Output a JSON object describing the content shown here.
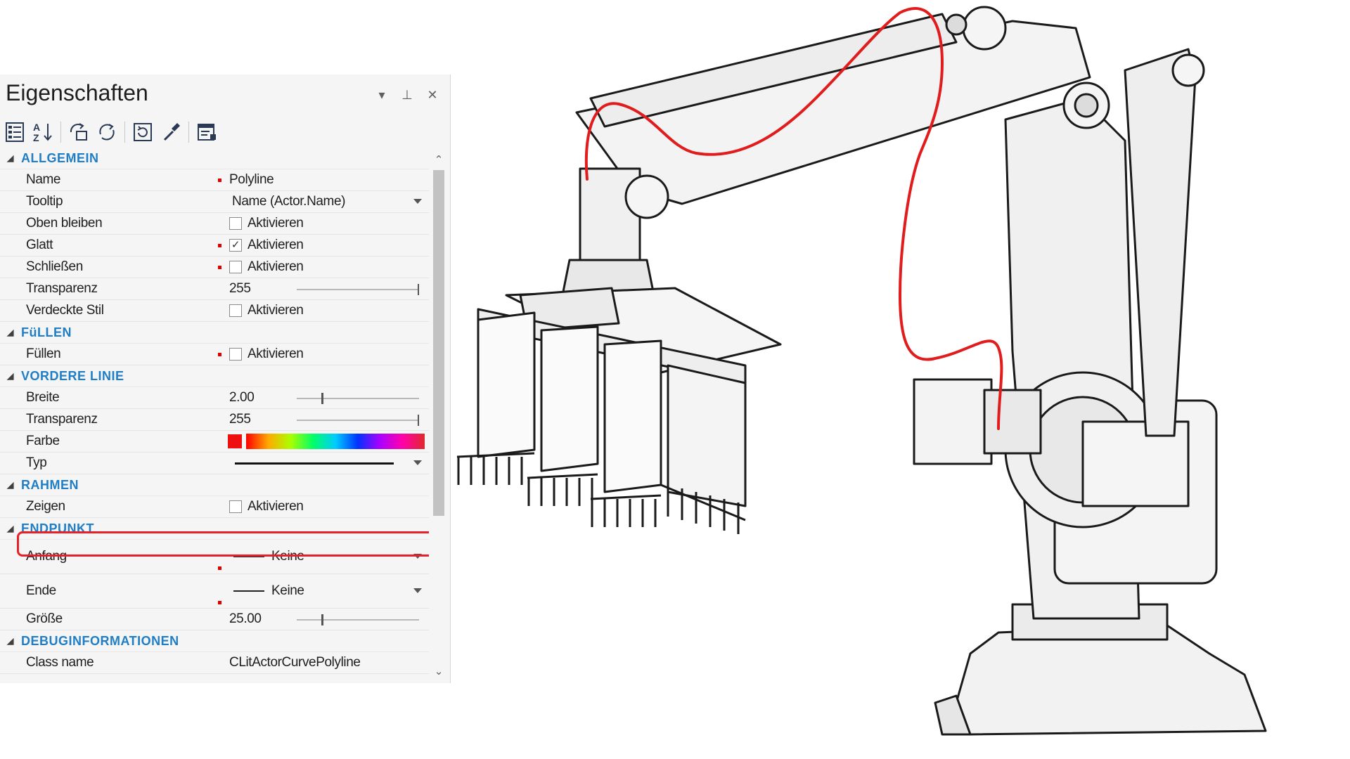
{
  "panel": {
    "title": "Eigenschaften",
    "title_buttons": [
      "dropdown-icon",
      "pin-icon",
      "close-icon"
    ],
    "toolbar_icons": [
      "categorized-icon",
      "alphabetical-sort-icon",
      "import-icon",
      "refresh-icon",
      "reset-icon",
      "eyedropper-icon",
      "property-page-icon"
    ]
  },
  "categories": {
    "allgemein": "ALLGEMEIN",
    "fuellen": "FüLLEN",
    "vordere_linie": "VORDERE LINIE",
    "rahmen": "RAHMEN",
    "endpunkt": "ENDPUNKT",
    "debug": "DEBUGINFORMATIONEN"
  },
  "props": {
    "name": {
      "label": "Name",
      "value": "Polyline"
    },
    "tooltip": {
      "label": "Tooltip",
      "value": "Name (Actor.Name)"
    },
    "oben_bleiben": {
      "label": "Oben bleiben",
      "value": "Aktivieren",
      "checked": false
    },
    "glatt": {
      "label": "Glatt",
      "value": "Aktivieren",
      "checked": true
    },
    "schliessen": {
      "label": "Schließen",
      "value": "Aktivieren",
      "checked": false
    },
    "transparenz": {
      "label": "Transparenz",
      "value": "255",
      "level": 1.0
    },
    "verdeckte_stil": {
      "label": "Verdeckte Stil",
      "value": "Aktivieren",
      "checked": false
    },
    "fuellen": {
      "label": "Füllen",
      "value": "Aktivieren",
      "checked": false
    },
    "breite": {
      "label": "Breite",
      "value": "2.00",
      "level": 0.2
    },
    "transparenz2": {
      "label": "Transparenz",
      "value": "255",
      "level": 1.0
    },
    "farbe": {
      "label": "Farbe",
      "color": "#ee1010"
    },
    "typ": {
      "label": "Typ"
    },
    "zeigen": {
      "label": "Zeigen",
      "value": "Aktivieren",
      "checked": false
    },
    "anfang": {
      "label": "Anfang",
      "value": "Keine"
    },
    "ende": {
      "label": "Ende",
      "value": "Keine"
    },
    "groesse": {
      "label": "Größe",
      "value": "25.00",
      "level": 0.2
    },
    "class_name": {
      "label": "Class name",
      "value": "CLitActorCurvePolyline"
    }
  },
  "colors": {
    "accent": "#1f7ec6",
    "highlight": "#e8202a",
    "polyline": "#e01c1c"
  }
}
